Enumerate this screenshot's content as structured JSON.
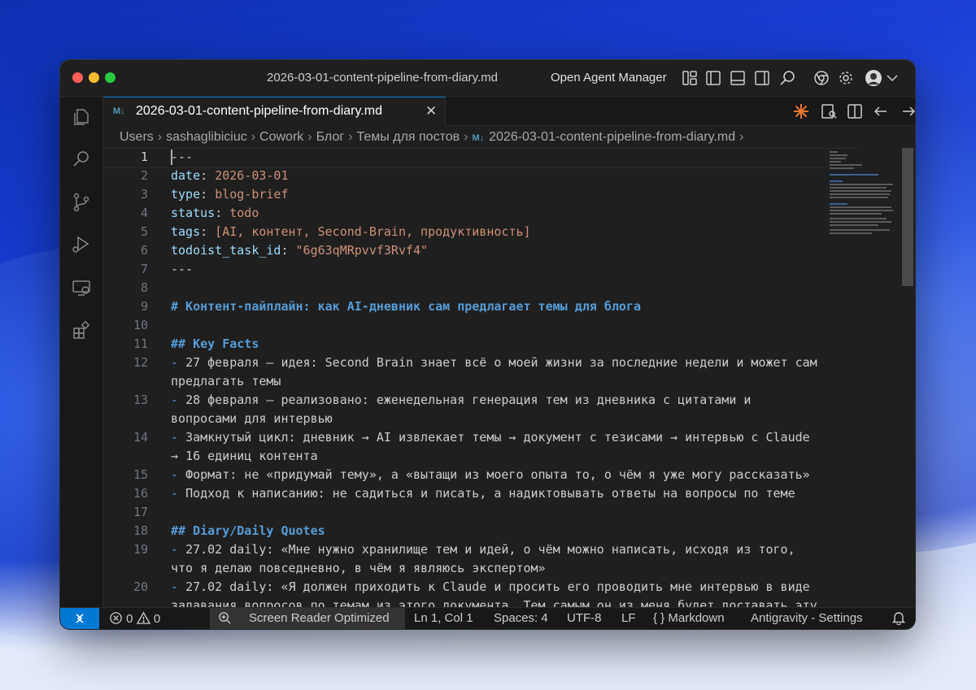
{
  "window": {
    "title": "2026-03-01-content-pipeline-from-diary.md",
    "agent_manager_label": "Open Agent Manager"
  },
  "tab": {
    "icon_label": "M↓",
    "name": "2026-03-01-content-pipeline-from-diary.md",
    "close_glyph": "✕"
  },
  "breadcrumb": {
    "items": [
      "Users",
      "sashaglibiciuc",
      "Cowork",
      "Блог",
      "Темы для постов"
    ],
    "file_icon": "M↓",
    "file": "2026-03-01-content-pipeline-from-diary.md",
    "separator": "›"
  },
  "editor": {
    "line_numbers": [
      "1",
      "2",
      "3",
      "4",
      "5",
      "6",
      "7",
      "8",
      "9",
      "10",
      "11",
      "12",
      "13",
      "14",
      "15",
      "16",
      "17",
      "18",
      "19",
      "20"
    ],
    "lines": {
      "l1": "---",
      "l2_key": "date",
      "l2_sep": ": ",
      "l2_val": "2026-03-01",
      "l3_key": "type",
      "l3_sep": ": ",
      "l3_val": "blog-brief",
      "l4_key": "status",
      "l4_sep": ": ",
      "l4_val": "todo",
      "l5_key": "tags",
      "l5_sep": ": ",
      "l5_val": "[AI, контент, Second-Brain, продуктивность]",
      "l6_key": "todoist_task_id",
      "l6_sep": ": ",
      "l6_val": "\"6g63qMRpvvf3Rvf4\"",
      "l7": "---",
      "l9": "# Контент-пайплайн: как AI-дневник сам предлагает темы для блога",
      "l11": "## Key Facts",
      "l12a": "27 февраля — идея: Second Brain знает всё о моей жизни за последние недели и может сам",
      "l12b": "предлагать темы",
      "l13a": "28 февраля — реализовано: еженедельная генерация тем из дневника с цитатами и",
      "l13b": "вопросами для интервью",
      "l14a": "Замкнутый цикл: дневник → AI извлекает темы → документ с тезисами → интервью с Claude",
      "l14b": "→ 16 единиц контента",
      "l15": "Формат: не «придумай тему», а «вытащи из моего опыта то, о чём я уже могу рассказать»",
      "l16": "Подход к написанию: не садиться и писать, а надиктовывать ответы на вопросы по теме",
      "l18": "## Diary/Daily Quotes",
      "l19a": "27.02 daily: «Мне нужно хранилище тем и идей, о чём можно написать, исходя из того,",
      "l19b": "что я делаю повседневно, в чём я являюсь экспертом»",
      "l20a": "27.02 daily: «Я должен приходить к Claude и просить его проводить мне интервью в виде",
      "l20b": "задавания вопросов по темам из этого документа. Тем самым он из меня будет доставать эту",
      "bullet": "- "
    }
  },
  "status": {
    "errors": "0",
    "warnings": "0",
    "screen_reader": "Screen Reader Optimized",
    "position": "Ln 1, Col 1",
    "spaces": "Spaces: 4",
    "encoding": "UTF-8",
    "eol": "LF",
    "language_braces": "{ }",
    "language": "Markdown",
    "settings": "Antigravity - Settings"
  },
  "colors": {
    "accent": "#0078d4",
    "markdown_icon": "#519aba",
    "key": "#9cdcfe",
    "string": "#ce9178",
    "heading": "#569cd6",
    "agent_icon": "#e8742e"
  }
}
